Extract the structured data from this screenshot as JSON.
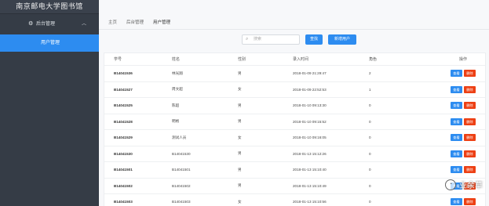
{
  "sidebar": {
    "brand": "南京邮电大学图书馆",
    "group_label": "后台管理",
    "group_icon": "gear-icon",
    "group_chevron": "chevron-up-icon",
    "active_item": "用户管理"
  },
  "breadcrumb": [
    "主页",
    "后台管理",
    "用户管理"
  ],
  "toolbar": {
    "search_placeholder": "搜索",
    "search_button": "查找",
    "add_button": "新增用户"
  },
  "table": {
    "columns": [
      "学号",
      "姓名",
      "性别",
      "录入时间",
      "角色",
      "操作"
    ],
    "action_labels": {
      "view": "查看",
      "delete": "删除"
    },
    "colors": {
      "view": "#2d8cf0",
      "delete": "#ed4014"
    },
    "rows": [
      {
        "id": "B14041536",
        "name": "林光翔",
        "gender": "男",
        "time": "2018-01-09 21:29:47",
        "role": "2"
      },
      {
        "id": "B14041527",
        "name": "周文超",
        "gender": "女",
        "time": "2018-01-09 22:52:53",
        "role": "1"
      },
      {
        "id": "B14041525",
        "name": "陈超",
        "gender": "男",
        "time": "2018-01-10 09:13:30",
        "role": "0"
      },
      {
        "id": "B14041528",
        "name": "明格",
        "gender": "男",
        "time": "2018-01-10 09:15:52",
        "role": "0"
      },
      {
        "id": "B14041529",
        "name": "测试人员",
        "gender": "女",
        "time": "2018-01-10 09:16:05",
        "role": "0"
      },
      {
        "id": "B14041530",
        "name": "B14041530",
        "gender": "男",
        "time": "2018-01-13 15:12:26",
        "role": "0"
      },
      {
        "id": "B14041501",
        "name": "B14041501",
        "gender": "男",
        "time": "2018-01-13 15:10:40",
        "role": "0"
      },
      {
        "id": "B14041502",
        "name": "B14041502",
        "gender": "男",
        "time": "2018-01-13 15:10:49",
        "role": "0"
      },
      {
        "id": "B14041503",
        "name": "B14041503",
        "gender": "女",
        "time": "2018-01-13 15:10:56",
        "role": "0"
      }
    ]
  },
  "watermark": {
    "text": "业余草"
  }
}
